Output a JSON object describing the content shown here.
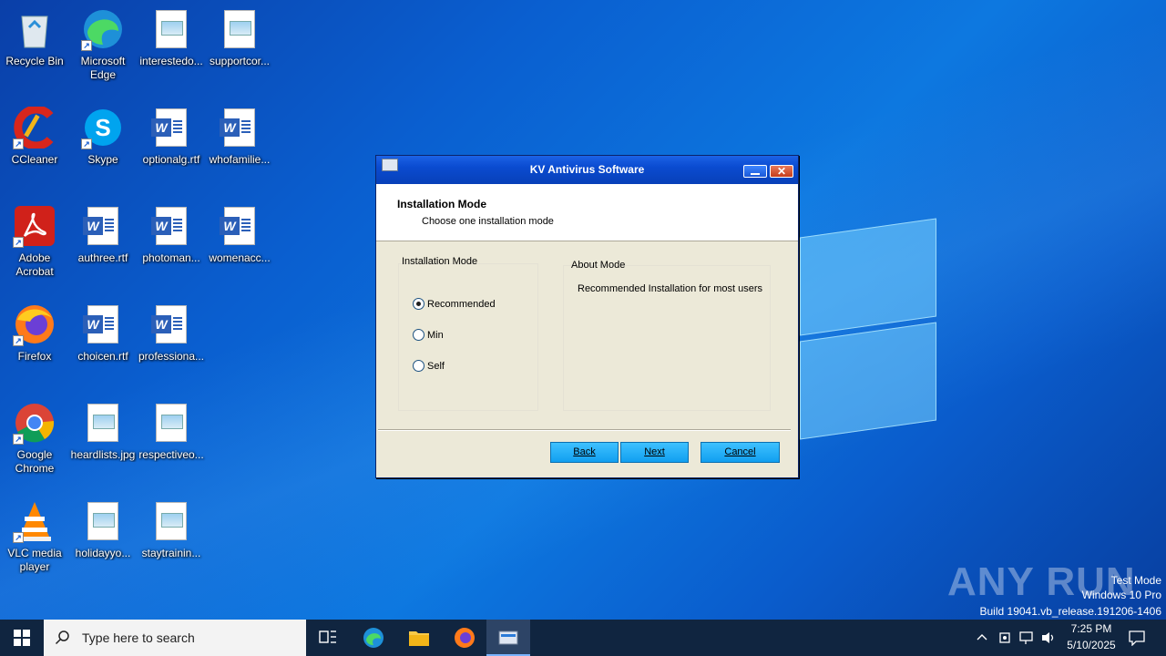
{
  "desktop": {
    "icons": [
      {
        "label": "Recycle Bin",
        "icon": "recycle-bin-icon"
      },
      {
        "label": "Microsoft\nEdge",
        "icon": "edge-icon"
      },
      {
        "label": "interestedo...",
        "icon": "image-file-icon"
      },
      {
        "label": "supportcor...",
        "icon": "image-file-icon"
      },
      {
        "label": "CCleaner",
        "icon": "ccleaner-icon"
      },
      {
        "label": "Skype",
        "icon": "skype-icon"
      },
      {
        "label": "optionalg.rtf",
        "icon": "word-doc-icon"
      },
      {
        "label": "whofamilie...",
        "icon": "word-doc-icon"
      },
      {
        "label": "Adobe\nAcrobat",
        "icon": "acrobat-icon"
      },
      {
        "label": "authree.rtf",
        "icon": "word-doc-icon"
      },
      {
        "label": "photoman...",
        "icon": "word-doc-icon"
      },
      {
        "label": "womenacc...",
        "icon": "word-doc-icon"
      },
      {
        "label": "Firefox",
        "icon": "firefox-icon"
      },
      {
        "label": "choicen.rtf",
        "icon": "word-doc-icon"
      },
      {
        "label": "professiona...",
        "icon": "word-doc-icon"
      },
      {
        "label": "Google\nChrome",
        "icon": "chrome-icon"
      },
      {
        "label": "heardlists.jpg",
        "icon": "image-file-icon"
      },
      {
        "label": "respectiveo...",
        "icon": "image-file-icon"
      },
      {
        "label": "VLC media\nplayer",
        "icon": "vlc-icon"
      },
      {
        "label": "holidayyo...",
        "icon": "image-file-icon"
      },
      {
        "label": "staytrainin...",
        "icon": "image-file-icon"
      }
    ]
  },
  "dialog": {
    "title": "KV Antivirus Software",
    "header_title": "Installation Mode",
    "header_subtitle": "Choose one installation mode",
    "mode_group_label": "Installation Mode",
    "about_group_label": "About Mode",
    "about_text": "Recommended Installation for most users",
    "options": [
      {
        "label": "Recommended",
        "selected": true
      },
      {
        "label": "Min",
        "selected": false
      },
      {
        "label": "Self",
        "selected": false
      }
    ],
    "buttons": {
      "back": "Back",
      "next": "Next",
      "cancel": "Cancel"
    },
    "button_color": "#22b0f8"
  },
  "watermark": {
    "brand": "ANY RUN",
    "line1": "Test Mode",
    "line2": "Windows 10 Pro",
    "line3": "Build 19041.vb_release.191206-1406"
  },
  "taskbar": {
    "search_placeholder": "Type here to search",
    "time": "7:25 PM",
    "date": "5/10/2025"
  }
}
